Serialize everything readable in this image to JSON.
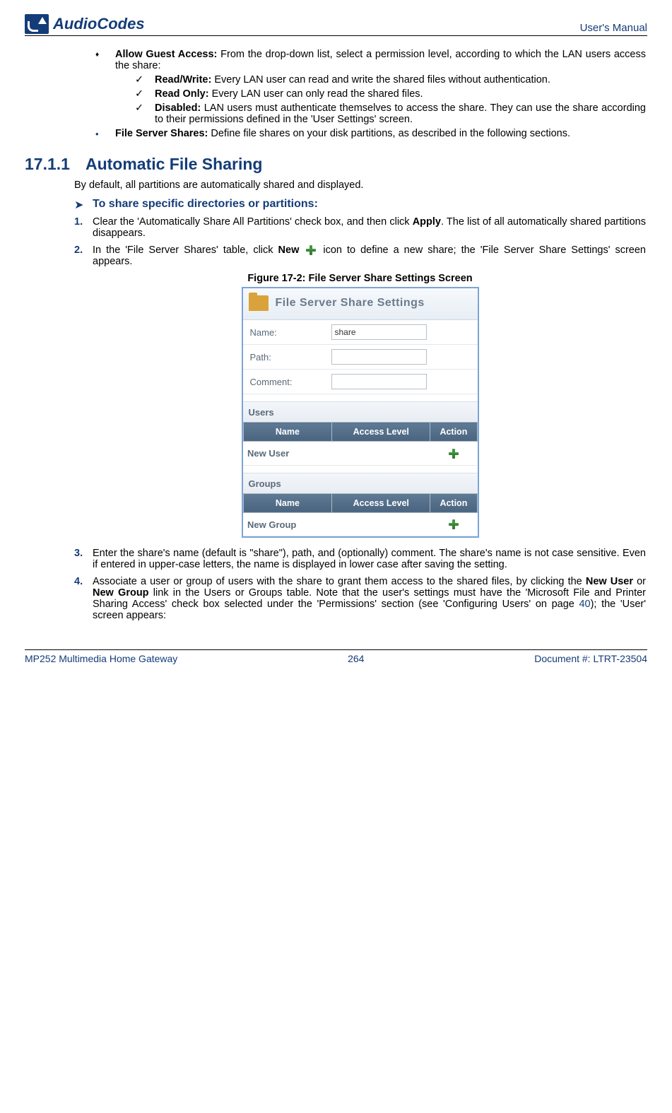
{
  "header": {
    "logo_text": "AudioCodes",
    "right_text": "User's Manual"
  },
  "bullets": {
    "allow_guest_label": "Allow Guest Access:",
    "allow_guest_text": " From the drop-down list, select a permission level, according to which the LAN users access the share:",
    "read_write_label": "Read/Write:",
    "read_write_text": " Every LAN user can read and write the shared files without authentication.",
    "read_only_label": "Read Only:",
    "read_only_text": " Every LAN user can only read the shared files.",
    "disabled_label": "Disabled:",
    "disabled_text": " LAN users must authenticate themselves to access the share. They can use the share according to their permissions defined in the 'User Settings' screen.",
    "file_server_label": "File Server Shares:",
    "file_server_text": " Define file shares on your disk partitions, as described in the following sections."
  },
  "section": {
    "number": "17.1.1",
    "title": "Automatic File Sharing",
    "intro": "By default, all partitions are automatically shared and displayed.",
    "arrow_text": "To share specific directories or partitions:"
  },
  "steps": {
    "s1_a": "Clear the 'Automatically Share All Partitions' check box, and then click ",
    "s1_b": "Apply",
    "s1_c": ". The list of all automatically shared partitions disappears.",
    "s2_a": "In the 'File Server Shares' table, click ",
    "s2_b": "New",
    "s2_c": " icon to define a new share; the 'File Server Share Settings' screen appears.",
    "s3": "Enter the share's name (default is \"share\"), path, and (optionally) comment. The share's name is not case sensitive. Even if entered in upper-case letters, the name is displayed in lower case after saving the setting.",
    "s4_a": "Associate a user or group of users with the share to grant them access to the shared files, by clicking the ",
    "s4_b": "New User",
    "s4_c": " or ",
    "s4_d": "New Group",
    "s4_e": " link in the Users or Groups table. Note that the user's settings must have the 'Microsoft File and Printer Sharing Access' check box selected under the 'Permissions' section (see 'Configuring Users' on page ",
    "s4_link": "40",
    "s4_f": "); the 'User' screen appears:"
  },
  "figure": {
    "caption": "Figure 17-2: File Server Share Settings Screen",
    "title": "File Server Share Settings",
    "name_label": "Name:",
    "name_value": "share",
    "path_label": "Path:",
    "comment_label": "Comment:",
    "users_section": "Users",
    "groups_section": "Groups",
    "col_name": "Name",
    "col_level": "Access Level",
    "col_action": "Action",
    "new_user": "New User",
    "new_group": "New Group"
  },
  "footer": {
    "left": "MP252 Multimedia Home Gateway",
    "center": "264",
    "right": "Document #: LTRT-23504"
  }
}
